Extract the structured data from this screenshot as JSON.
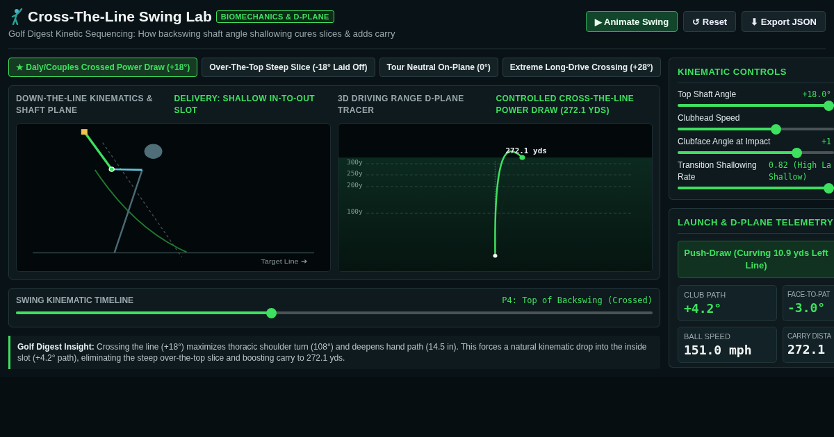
{
  "header": {
    "title": "Cross-The-Line Swing Lab",
    "badge": "BIOMECHANICS & D-PLANE",
    "subtitle": "Golf Digest Kinetic Sequencing: How backswing shaft angle shallowing cures slices & adds carry",
    "buttons": [
      {
        "label": "▶ Animate Swing",
        "kind": "primary"
      },
      {
        "label": "↺ Reset",
        "kind": "plain"
      },
      {
        "label": "⬇ Export JSON",
        "kind": "plain"
      }
    ]
  },
  "presets": [
    {
      "label": "★ Daly/Couples Crossed Power Draw (+18°)",
      "selected": true
    },
    {
      "label": "Over-The-Top Steep Slice (-18° Laid Off)",
      "selected": false
    },
    {
      "label": "Tour Neutral On-Plane (0°)",
      "selected": false
    },
    {
      "label": "Extreme Long-Drive Crossing (+28°)",
      "selected": false
    }
  ],
  "kinematics_panel": {
    "title": "DOWN-THE-LINE KINEMATICS & SHAFT PLANE",
    "status": "DELIVERY: SHALLOW IN-TO-OUT SLOT",
    "target_label": "Target Line ➔"
  },
  "tracer_panel": {
    "title": "3D DRIVING RANGE D-PLANE TRACER",
    "status": "CONTROLLED CROSS-THE-LINE POWER DRAW (272.1 YDS)",
    "yard_lines": [
      "300y",
      "250y",
      "200y",
      "100y"
    ],
    "carry_label": "272.1 yds"
  },
  "timeline": {
    "title": "SWING KINEMATIC TIMELINE",
    "phase": "P4: Top of Backswing (Crossed)",
    "level": 0.4
  },
  "insight": "**Golf Digest Insight:** Crossing the line (+18°) maximizes thoracic shoulder turn (108°) and deepens hand path (14.5 in). This forces a natural kinematic drop into the inside slot (+4.2° path), eliminating the steep over-the-top slice and boosting carry to 272.1 yds.",
  "controls": {
    "title": "KINEMATIC CONTROLS",
    "sliders": [
      {
        "label": [
          "Top Shaft Angle"
        ],
        "value": [
          "+18.0°"
        ],
        "level": 1.0
      },
      {
        "label": [
          "Clubhead Speed"
        ],
        "level": 0.64
      },
      {
        "label": [
          "Clubface Angle at Impact"
        ],
        "value": [
          "+1"
        ],
        "level": 0.78
      },
      {
        "label": [
          "Transition Shallowing",
          "Rate"
        ],
        "value": [
          "0.82 (High La",
          "Shallow)"
        ],
        "level": 1.0
      }
    ]
  },
  "telemetry": {
    "title": "LAUNCH & D-PLANE TELEMETRY",
    "verdict": [
      "Push-Draw (Curving 10.9 yds Left",
      "Line)"
    ],
    "metrics": [
      {
        "label": "CLUB PATH",
        "value": "+4.2°",
        "kind": "accent"
      },
      {
        "label": "FACE-TO-PAT",
        "value": "-3.0°",
        "kind": "accent"
      },
      {
        "label": "BALL SPEED",
        "value": "151.0 mph",
        "kind": "plain"
      },
      {
        "label": "CARRY DISTA",
        "value": "272.1",
        "kind": "plain"
      }
    ]
  }
}
